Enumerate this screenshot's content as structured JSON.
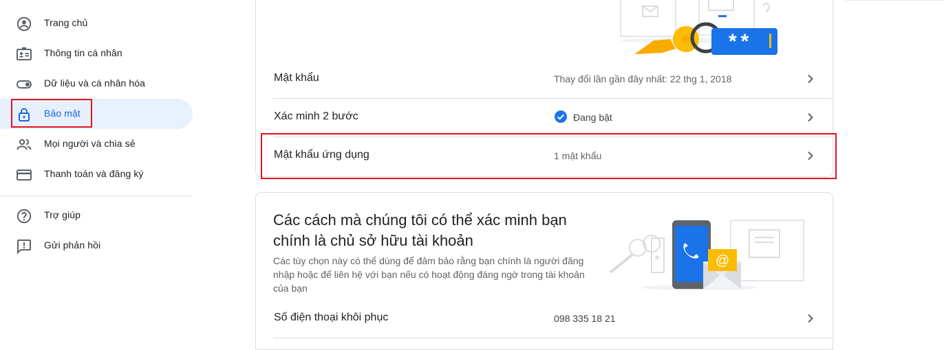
{
  "sidebar": {
    "items": [
      {
        "label": "Trang chủ",
        "icon": "home-account-icon"
      },
      {
        "label": "Thông tin cá nhân",
        "icon": "id-card-icon"
      },
      {
        "label": "Dữ liệu và cá nhân hóa",
        "icon": "toggle-icon"
      },
      {
        "label": "Bảo mật",
        "icon": "lock-icon",
        "active": true
      },
      {
        "label": "Mọi người và chia sẻ",
        "icon": "people-icon"
      },
      {
        "label": "Thanh toán và đăng ký",
        "icon": "credit-card-icon"
      },
      {
        "label": "Trợ giúp",
        "icon": "help-icon"
      },
      {
        "label": "Gửi phản hồi",
        "icon": "feedback-icon"
      }
    ]
  },
  "signin_card": {
    "rows": [
      {
        "title": "Mật khẩu",
        "value": "Thay đổi lần gần đây nhất: 22 thg 1, 2018"
      },
      {
        "title": "Xác minh 2 bước",
        "value": "Đang bật"
      },
      {
        "title": "Mật khẩu ứng dụng",
        "value": "1 mật khẩu"
      }
    ],
    "illustration_text": "**"
  },
  "verify_card": {
    "title": "Các cách mà chúng tôi có thể xác minh bạn chính là chủ sở hữu tài khoản",
    "description": "Các tùy chọn này có thể dùng để đảm bảo rằng bạn chính là người đăng nhập hoặc để liên hệ với bạn nếu có hoạt động đáng ngờ trong tài khoản của bạn",
    "rows": [
      {
        "title": "Số điện thoại khôi phục",
        "value": "098 335 18 21"
      }
    ]
  },
  "colors": {
    "accent": "#1a73e8",
    "active_bg": "#e8f0fe",
    "highlight": "#e0141e",
    "key_yellow": "#fbbc04"
  }
}
